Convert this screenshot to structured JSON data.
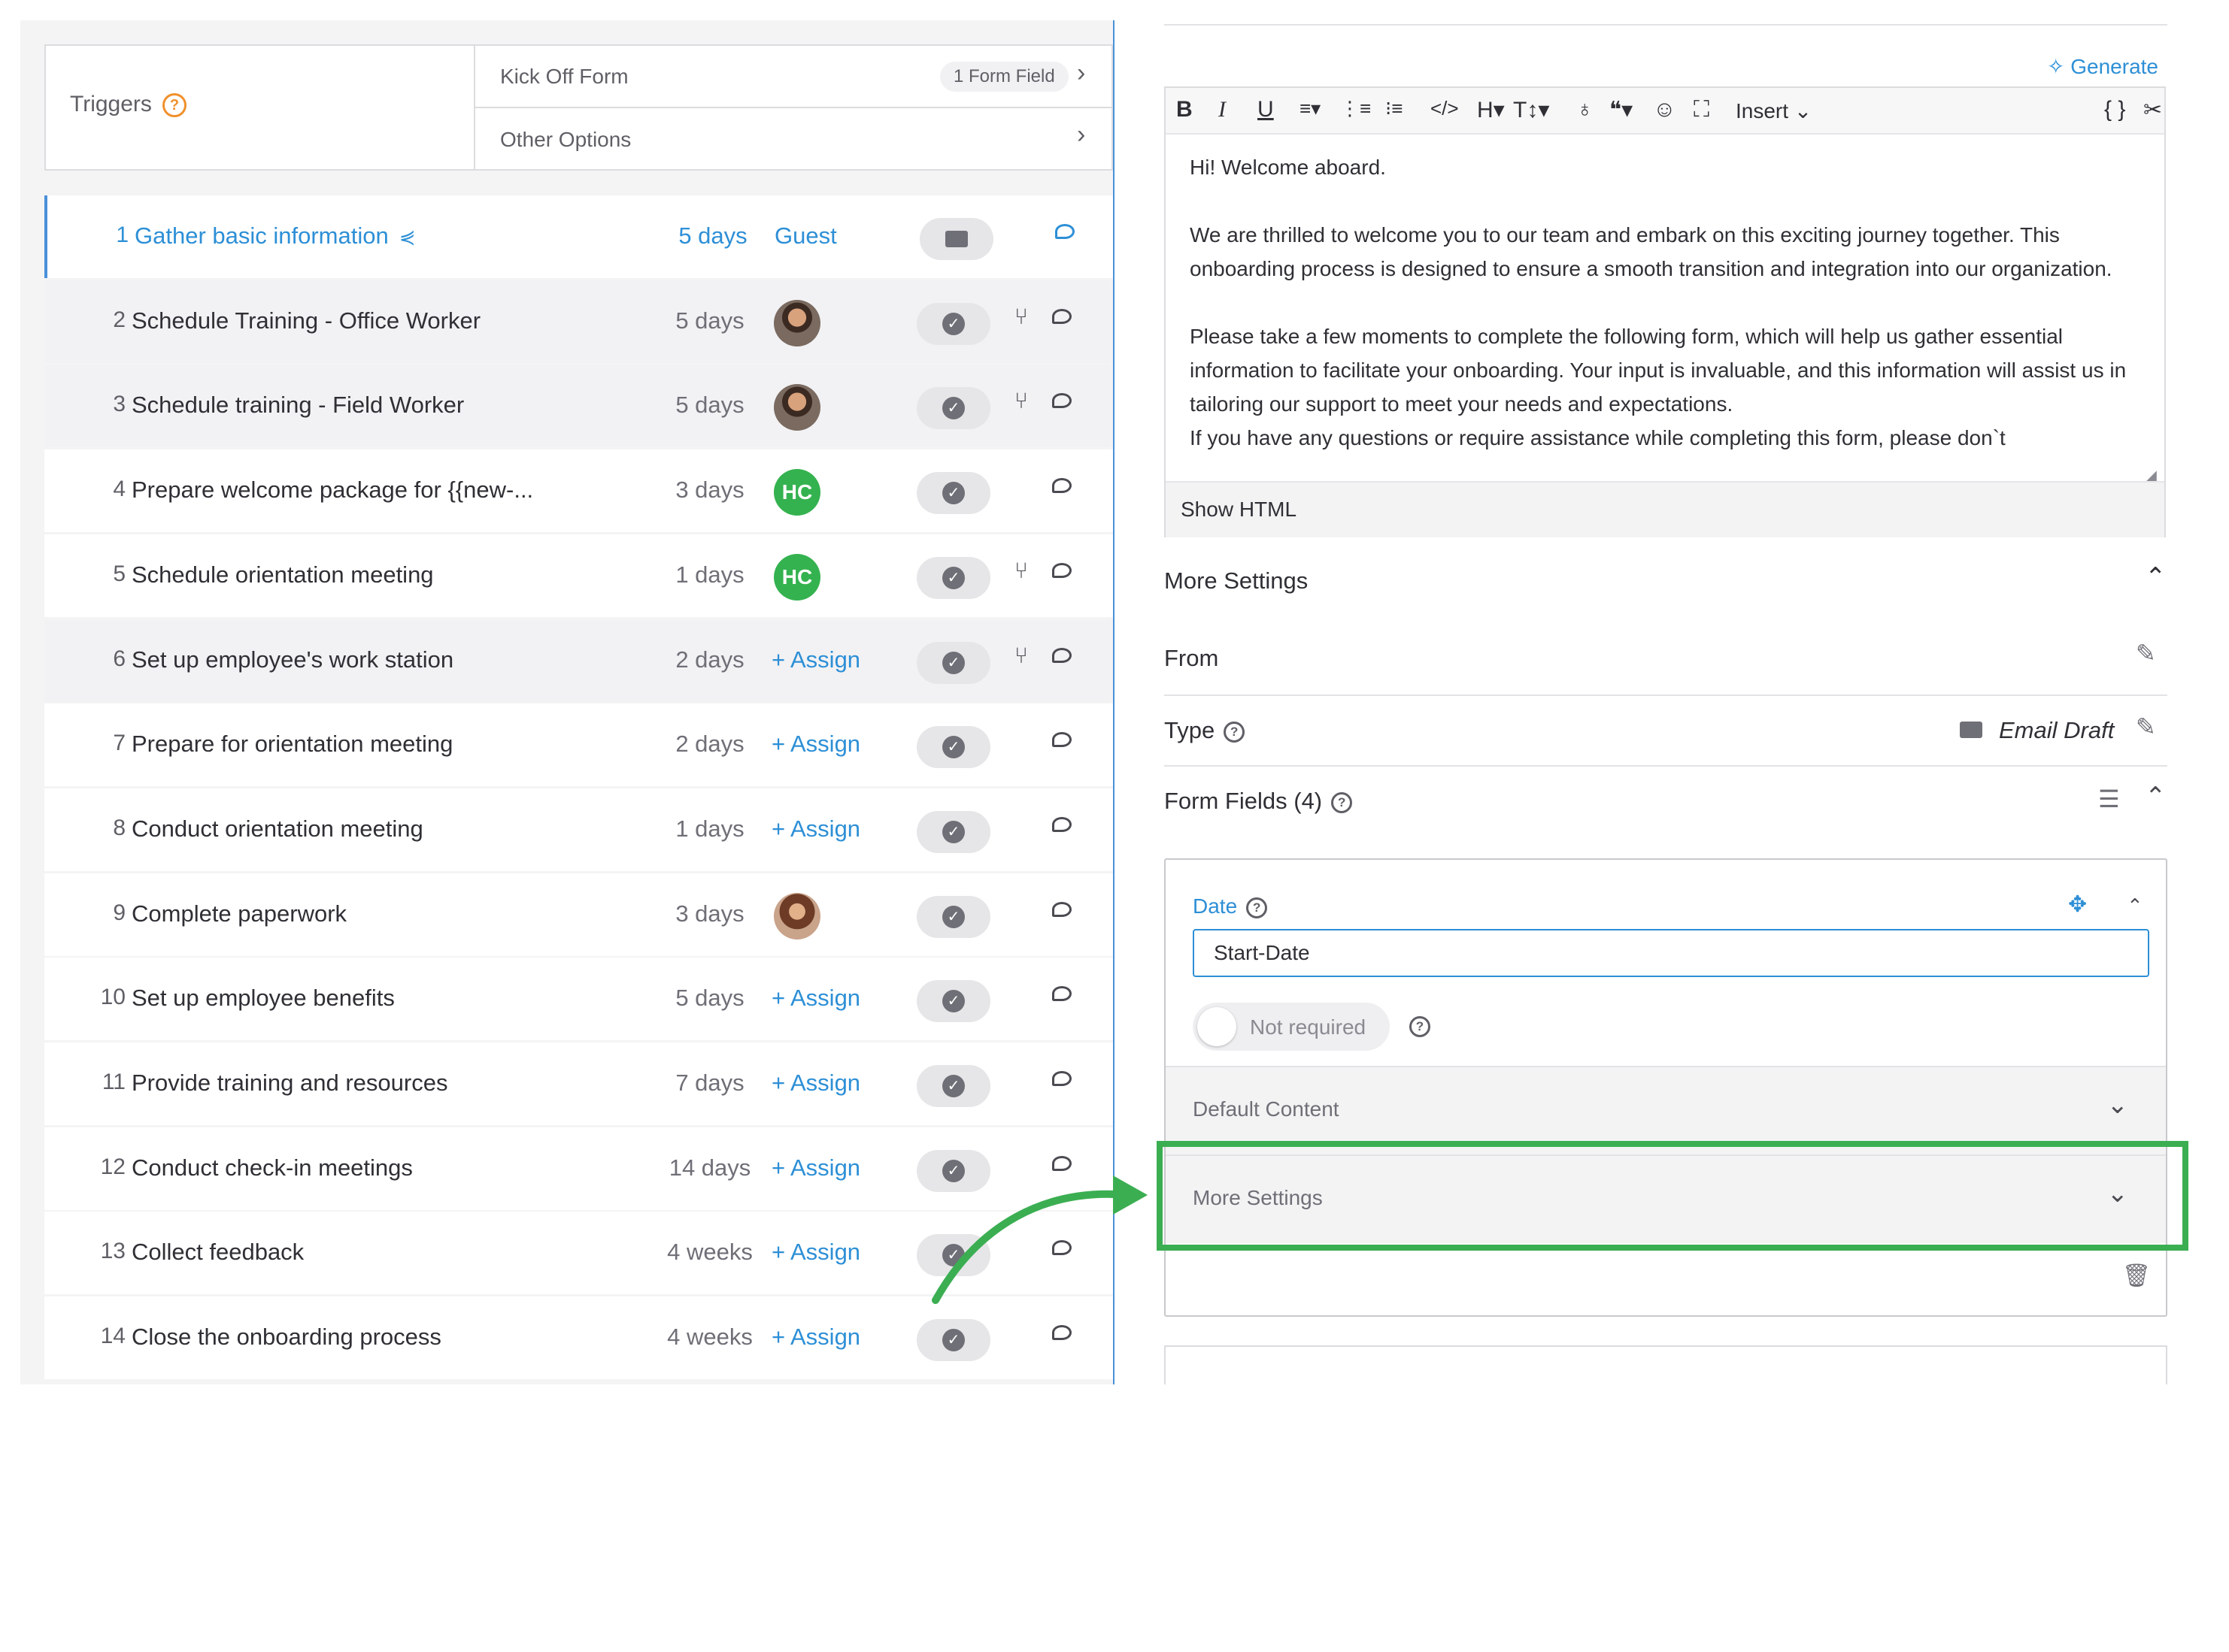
{
  "triggers": {
    "label": "Triggers",
    "help": "?",
    "kickoff_label": "Kick Off Form",
    "kickoff_badge": "1 Form Field",
    "other_label": "Other Options",
    "chevron": "›"
  },
  "tasks": [
    {
      "num": "1",
      "title": "Gather basic information",
      "duration": "5 days",
      "assignee": "Guest",
      "status": "envelope-icon",
      "icons": "comment-icon"
    },
    {
      "num": "2",
      "title": "Schedule Training - Office Worker",
      "duration": "5 days",
      "assignee": "avatar-photo",
      "status": "check-icon",
      "icons": "branch-icon comment-icon"
    },
    {
      "num": "3",
      "title": "Schedule training - Field Worker",
      "duration": "5 days",
      "assignee": "avatar-photo",
      "status": "check-icon",
      "icons": "branch-icon comment-icon"
    },
    {
      "num": "4",
      "title": "Prepare welcome package for {{new-...",
      "duration": "3 days",
      "assignee": "HC",
      "status": "check-icon",
      "icons": "comment-icon"
    },
    {
      "num": "5",
      "title": "Schedule orientation meeting",
      "duration": "1 days",
      "assignee": "HC",
      "status": "check-icon",
      "icons": "branch-icon comment-icon"
    },
    {
      "num": "6",
      "title": "Set up employee's work station",
      "duration": "2 days",
      "assignee": "+ Assign",
      "status": "check-icon",
      "icons": "branch-icon comment-icon"
    },
    {
      "num": "7",
      "title": "Prepare for orientation meeting",
      "duration": "2 days",
      "assignee": "+ Assign",
      "status": "check-icon",
      "icons": "comment-icon"
    },
    {
      "num": "8",
      "title": "Conduct orientation meeting",
      "duration": "1 days",
      "assignee": "+ Assign",
      "status": "check-icon",
      "icons": "comment-icon"
    },
    {
      "num": "9",
      "title": "Complete paperwork",
      "duration": "3 days",
      "assignee": "avatar-photo",
      "status": "check-icon",
      "icons": "comment-icon"
    },
    {
      "num": "10",
      "title": "Set up employee benefits",
      "duration": "5 days",
      "assignee": "+ Assign",
      "status": "check-icon",
      "icons": "comment-icon"
    },
    {
      "num": "11",
      "title": "Provide training and resources",
      "duration": "7 days",
      "assignee": "+ Assign",
      "status": "check-icon",
      "icons": "comment-icon"
    },
    {
      "num": "12",
      "title": "Conduct check-in meetings",
      "duration": "14 days",
      "assignee": "+ Assign",
      "status": "check-icon",
      "icons": "comment-icon"
    },
    {
      "num": "13",
      "title": "Collect feedback",
      "duration": "4 weeks",
      "assignee": "+ Assign",
      "status": "check-icon",
      "icons": "comment-icon"
    },
    {
      "num": "14",
      "title": "Close the onboarding process",
      "duration": "4 weeks",
      "assignee": "+ Assign",
      "status": "check-icon",
      "icons": "comment-icon"
    }
  ],
  "editor": {
    "generate_label": "Generate",
    "toolbar": {
      "bold": "B",
      "italic": "I",
      "underline": "U",
      "heading": "H",
      "textsize": "T↕",
      "insert": "Insert"
    },
    "paragraphs": [
      "Hi! Welcome aboard.",
      "We are thrilled to welcome you to our team and embark on this exciting journey together. This onboarding process is designed to ensure a smooth transition and integration into our organization.",
      "Please take a few moments to complete the following form, which will help us gather essential information to facilitate your onboarding. Your input is invaluable, and this information will assist us in tailoring our support to meet your needs and expectations.",
      "If you have any questions or require assistance while completing this form, please don`t"
    ],
    "show_html": "Show HTML"
  },
  "settings": {
    "more_settings": "More Settings",
    "from_label": "From",
    "type_label": "Type",
    "type_value": "Email Draft",
    "form_fields_label": "Form Fields (4)"
  },
  "field": {
    "label": "Date",
    "value": "Start-Date",
    "required_label": "Not required",
    "default_content": "Default Content",
    "more_settings": "More Settings"
  },
  "colors": {
    "accent": "#2d8fd6",
    "highlight": "#3bae52",
    "avatar_green": "#34b24f",
    "trigger_help": "#f0902c"
  }
}
